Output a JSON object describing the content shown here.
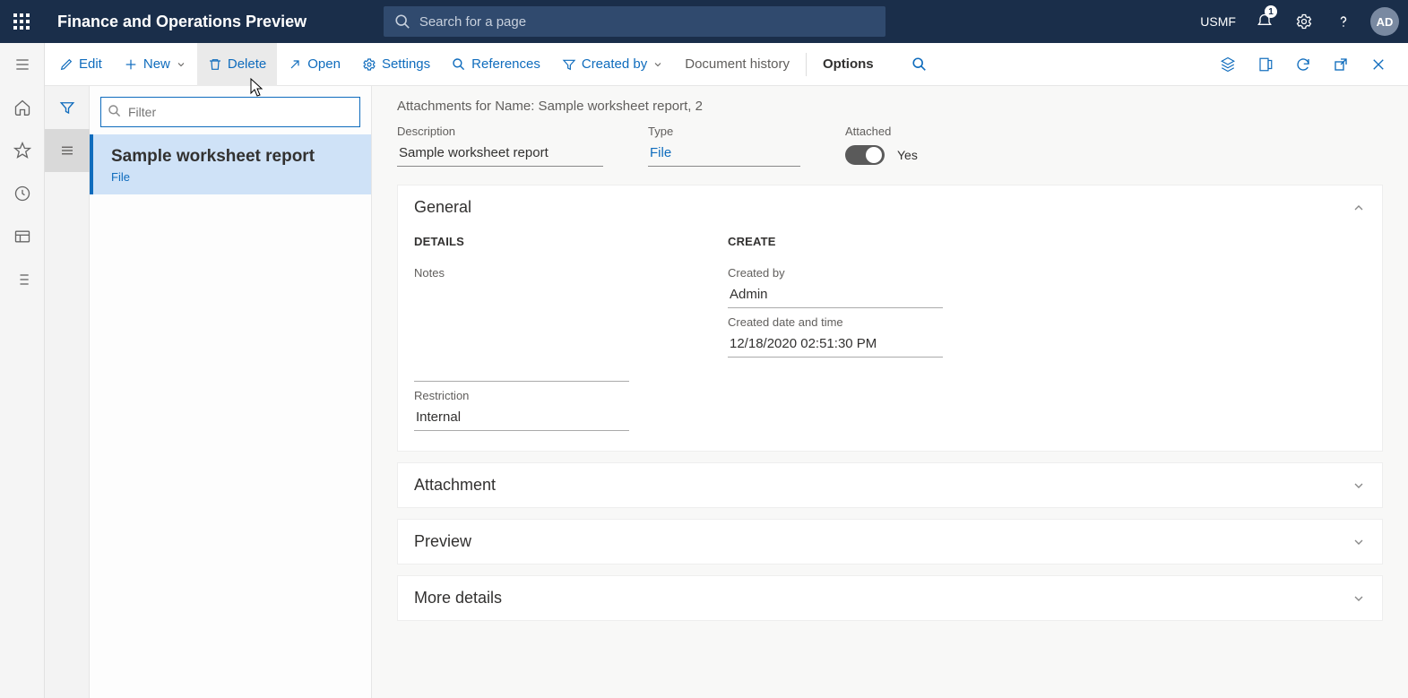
{
  "header": {
    "app_title": "Finance and Operations Preview",
    "search_placeholder": "Search for a page",
    "company": "USMF",
    "notification_count": "1",
    "avatar": "AD"
  },
  "actionbar": {
    "edit": "Edit",
    "new": "New",
    "delete": "Delete",
    "open": "Open",
    "settings": "Settings",
    "references": "References",
    "created_by": "Created by",
    "doc_history": "Document history",
    "options": "Options"
  },
  "list": {
    "filter_placeholder": "Filter",
    "items": [
      {
        "title": "Sample worksheet report",
        "type": "File"
      }
    ]
  },
  "detail": {
    "heading": "Attachments for Name: Sample worksheet report, 2",
    "fields": {
      "description_label": "Description",
      "description_value": "Sample worksheet report",
      "type_label": "Type",
      "type_value": "File",
      "attached_label": "Attached",
      "attached_value": "Yes"
    },
    "sections": {
      "general": {
        "title": "General",
        "details_heading": "DETAILS",
        "notes_label": "Notes",
        "restriction_label": "Restriction",
        "restriction_value": "Internal",
        "create_heading": "CREATE",
        "created_by_label": "Created by",
        "created_by_value": "Admin",
        "created_dt_label": "Created date and time",
        "created_dt_value": "12/18/2020 02:51:30 PM"
      },
      "attachment": {
        "title": "Attachment"
      },
      "preview": {
        "title": "Preview"
      },
      "more": {
        "title": "More details"
      }
    }
  }
}
